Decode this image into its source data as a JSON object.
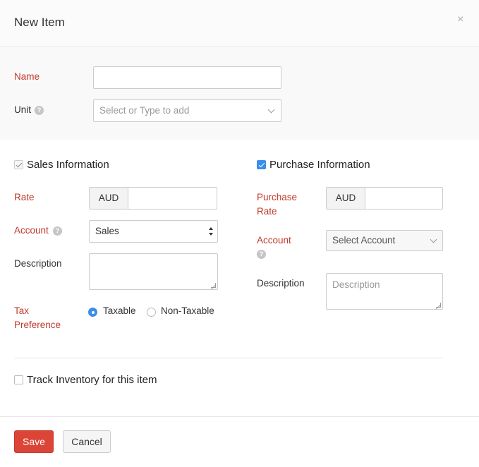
{
  "dialog": {
    "title": "New Item",
    "close_icon": "×"
  },
  "item": {
    "name_label": "Name",
    "name_value": "",
    "unit_label": "Unit",
    "unit_placeholder": "Select or Type to add"
  },
  "sales": {
    "section_label": "Sales Information",
    "checked": true,
    "rate_label": "Rate",
    "currency": "AUD",
    "rate_value": "",
    "account_label": "Account",
    "account_value": "Sales",
    "description_label": "Description",
    "description_value": "",
    "tax_label_line1": "Tax",
    "tax_label_line2": "Preference",
    "tax_options": [
      "Taxable",
      "Non-Taxable"
    ],
    "tax_selected": "Taxable"
  },
  "purchase": {
    "section_label": "Purchase Information",
    "checked": true,
    "rate_label_line1": "Purchase",
    "rate_label_line2": "Rate",
    "currency": "AUD",
    "rate_value": "",
    "account_label": "Account",
    "account_placeholder": "Select Account",
    "description_label": "Description",
    "description_placeholder": "Description"
  },
  "inventory": {
    "track_label": "Track Inventory for this item",
    "checked": false
  },
  "footer": {
    "save_label": "Save",
    "cancel_label": "Cancel"
  },
  "colors": {
    "required_label": "#c0392b",
    "primary_button": "#db4437",
    "checkbox_active": "#3b8eea"
  },
  "icons": {
    "help": "?",
    "close": "×"
  }
}
